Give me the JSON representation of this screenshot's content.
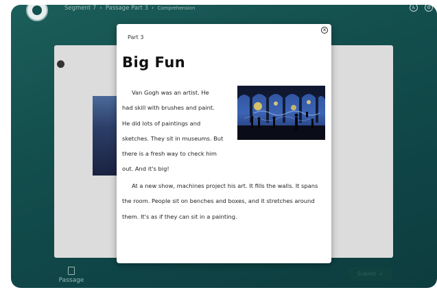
{
  "header": {
    "breadcrumb": [
      "Segment 7",
      "Passage Part 3",
      "Comprehension"
    ]
  },
  "modal": {
    "part": "Part 3",
    "title": "Big Fun",
    "close": "✕",
    "paragraph1_lines": [
      "Van Gogh was an artist. He",
      "had skill with brushes and paint.",
      "He did lots of paintings and",
      "sketches. They sit in museums. But",
      "there is a fresh way to check him",
      "out. And it's big!"
    ],
    "paragraph2_lines": [
      "At a new show, machines project his art. It fills the walls. It spans",
      "the room. People sit on benches and boxes, and it stretches around",
      "them. It's as if they can sit in a painting."
    ]
  },
  "bottom": {
    "passage_label": "Passage",
    "submit_label": "Submit",
    "submit_icon": "✓"
  },
  "icons": {
    "logo": "logo-icon",
    "close": "close-icon",
    "user": "user-icon",
    "passage": "document-icon",
    "accessibility": "accessibility-icon",
    "settings": "settings-icon"
  },
  "colors": {
    "background_teal": "#134f4d",
    "modal": "#ffffff",
    "panel": "#dcdcdc"
  }
}
